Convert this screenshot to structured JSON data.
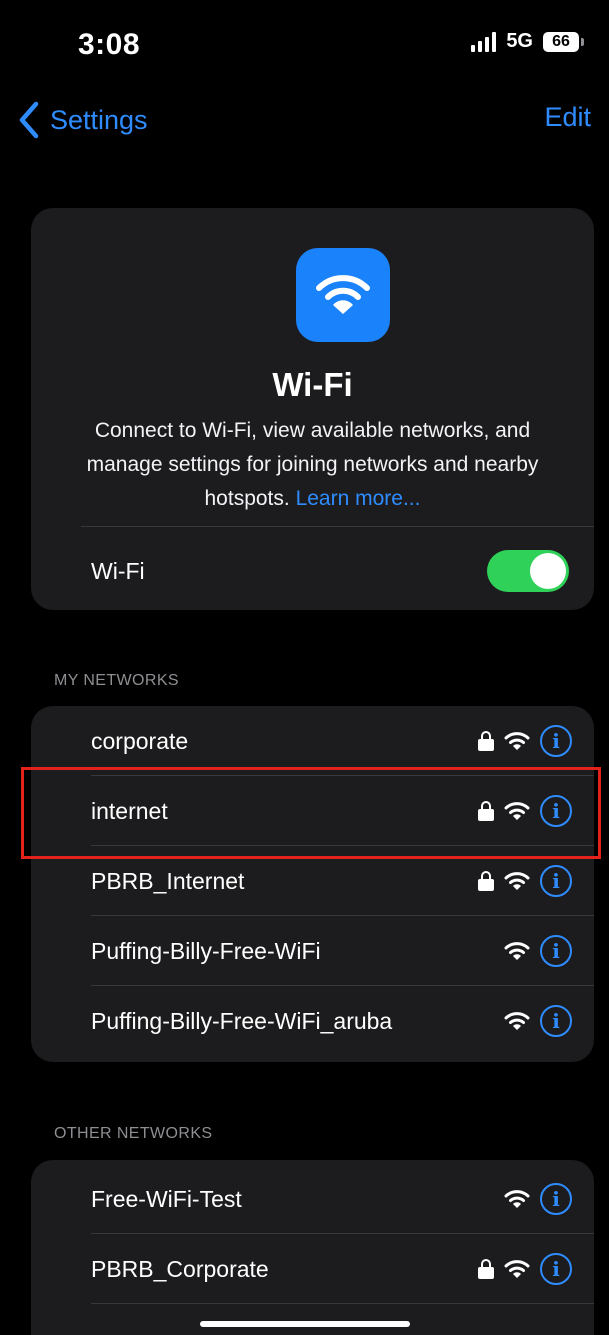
{
  "status_bar": {
    "time": "3:08",
    "network_type": "5G",
    "battery_level": "66"
  },
  "nav": {
    "back_label": "Settings",
    "edit_label": "Edit"
  },
  "hero": {
    "icon": "wifi-icon",
    "title": "Wi-Fi",
    "description": "Connect to Wi-Fi, view available networks, and manage settings for joining networks and nearby hotspots.",
    "learn_more": "Learn more...",
    "toggle_label": "Wi-Fi",
    "toggle_on": true
  },
  "my_networks": {
    "header": "MY NETWORKS",
    "items": [
      {
        "name": "corporate",
        "secured": true
      },
      {
        "name": "internet",
        "secured": true
      },
      {
        "name": "PBRB_Internet",
        "secured": true
      },
      {
        "name": "Puffing-Billy-Free-WiFi",
        "secured": false
      },
      {
        "name": "Puffing-Billy-Free-WiFi_aruba",
        "secured": false
      }
    ]
  },
  "other_networks": {
    "header": "OTHER NETWORKS",
    "items": [
      {
        "name": "Free-WiFi-Test",
        "secured": false
      },
      {
        "name": "PBRB_Corporate",
        "secured": true
      }
    ]
  },
  "colors": {
    "accent": "#2f8cff",
    "toggle_on": "#30d158",
    "highlight": "#e3231b",
    "card_bg": "#1c1c1e"
  }
}
